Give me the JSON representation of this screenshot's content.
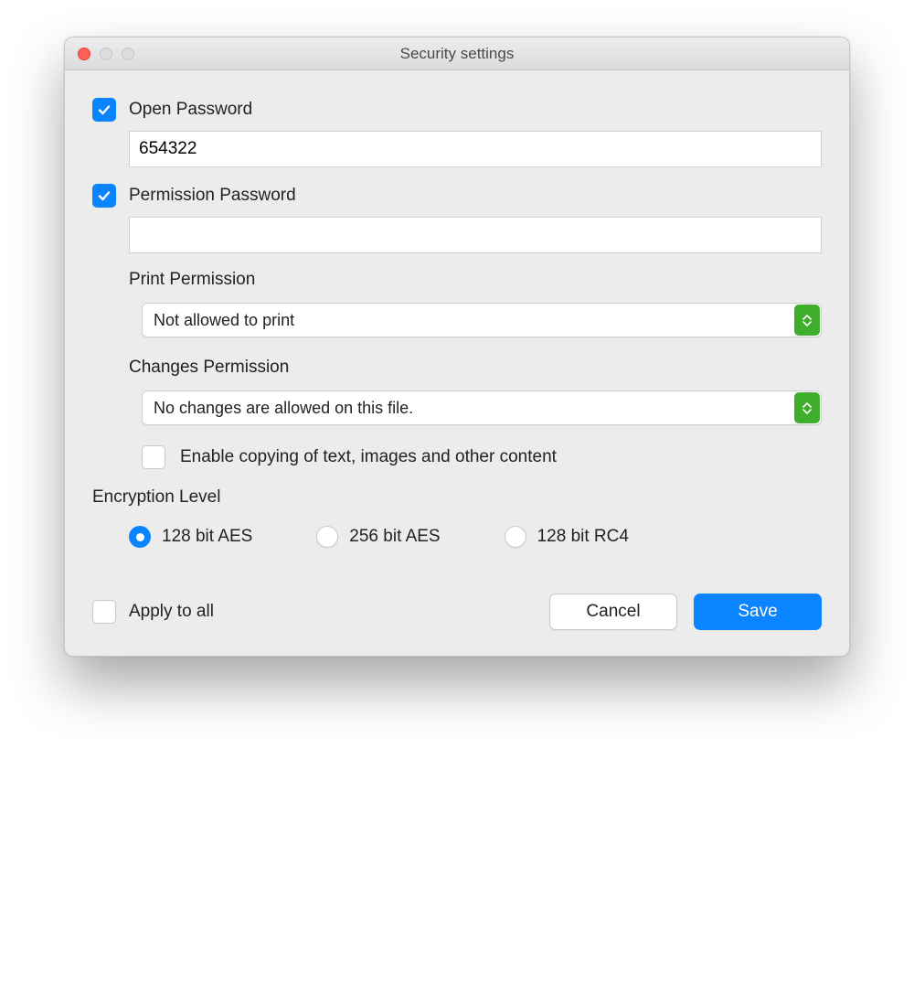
{
  "window": {
    "title": "Security settings"
  },
  "open_password": {
    "label": "Open Password",
    "checked": true,
    "value": "654322"
  },
  "permission_password": {
    "label": "Permission Password",
    "checked": true,
    "value": ""
  },
  "print_permission": {
    "label": "Print Permission",
    "selected": "Not allowed to print"
  },
  "changes_permission": {
    "label": "Changes Permission",
    "selected": "No changes are allowed on this file."
  },
  "enable_copy": {
    "label": "Enable copying of text, images and other content",
    "checked": false
  },
  "encryption": {
    "label": "Encryption Level",
    "options": [
      {
        "label": "128 bit AES",
        "selected": true
      },
      {
        "label": "256 bit AES",
        "selected": false
      },
      {
        "label": "128 bit RC4",
        "selected": false
      }
    ]
  },
  "footer": {
    "apply_all": {
      "label": "Apply to all",
      "checked": false
    },
    "cancel": "Cancel",
    "save": "Save"
  }
}
